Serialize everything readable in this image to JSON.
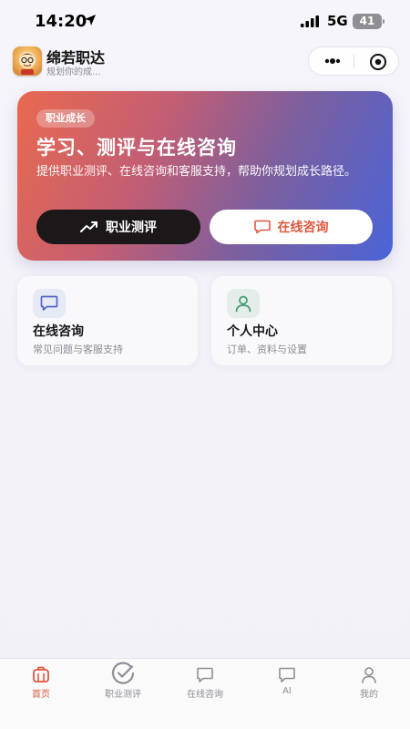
{
  "status_bar": {
    "time": "14:20",
    "network": "5G",
    "battery": "41"
  },
  "app": {
    "name": "绵若职达",
    "subtitle": "规划你的成...",
    "logo_icon": "app-logo-icon"
  },
  "hero": {
    "tag": "职业成长",
    "title": "学习、测评与在线咨询",
    "description": "提供职业测评、在线咨询和客服支持，帮助你规划成长路径。",
    "primary_button": "职业测评",
    "secondary_button": "在线咨询",
    "colors": {
      "start": "#e9694f",
      "end": "#4a64d8",
      "accent": "#e0573e"
    }
  },
  "cards": [
    {
      "title": "在线咨询",
      "subtitle": "常见问题与客服支持",
      "icon": "chat-icon"
    },
    {
      "title": "个人中心",
      "subtitle": "订单、资料与设置",
      "icon": "user-icon"
    }
  ],
  "tab_bar": {
    "items": [
      {
        "label": "首页",
        "icon": "home-icon",
        "active": true
      },
      {
        "label": "职业测评",
        "icon": "check-circle-icon",
        "active": false
      },
      {
        "label": "在线咨询",
        "icon": "chat-icon",
        "active": false
      },
      {
        "label": "AI",
        "icon": "chat-icon",
        "active": false
      },
      {
        "label": "我的",
        "icon": "user-icon",
        "active": false
      }
    ]
  }
}
